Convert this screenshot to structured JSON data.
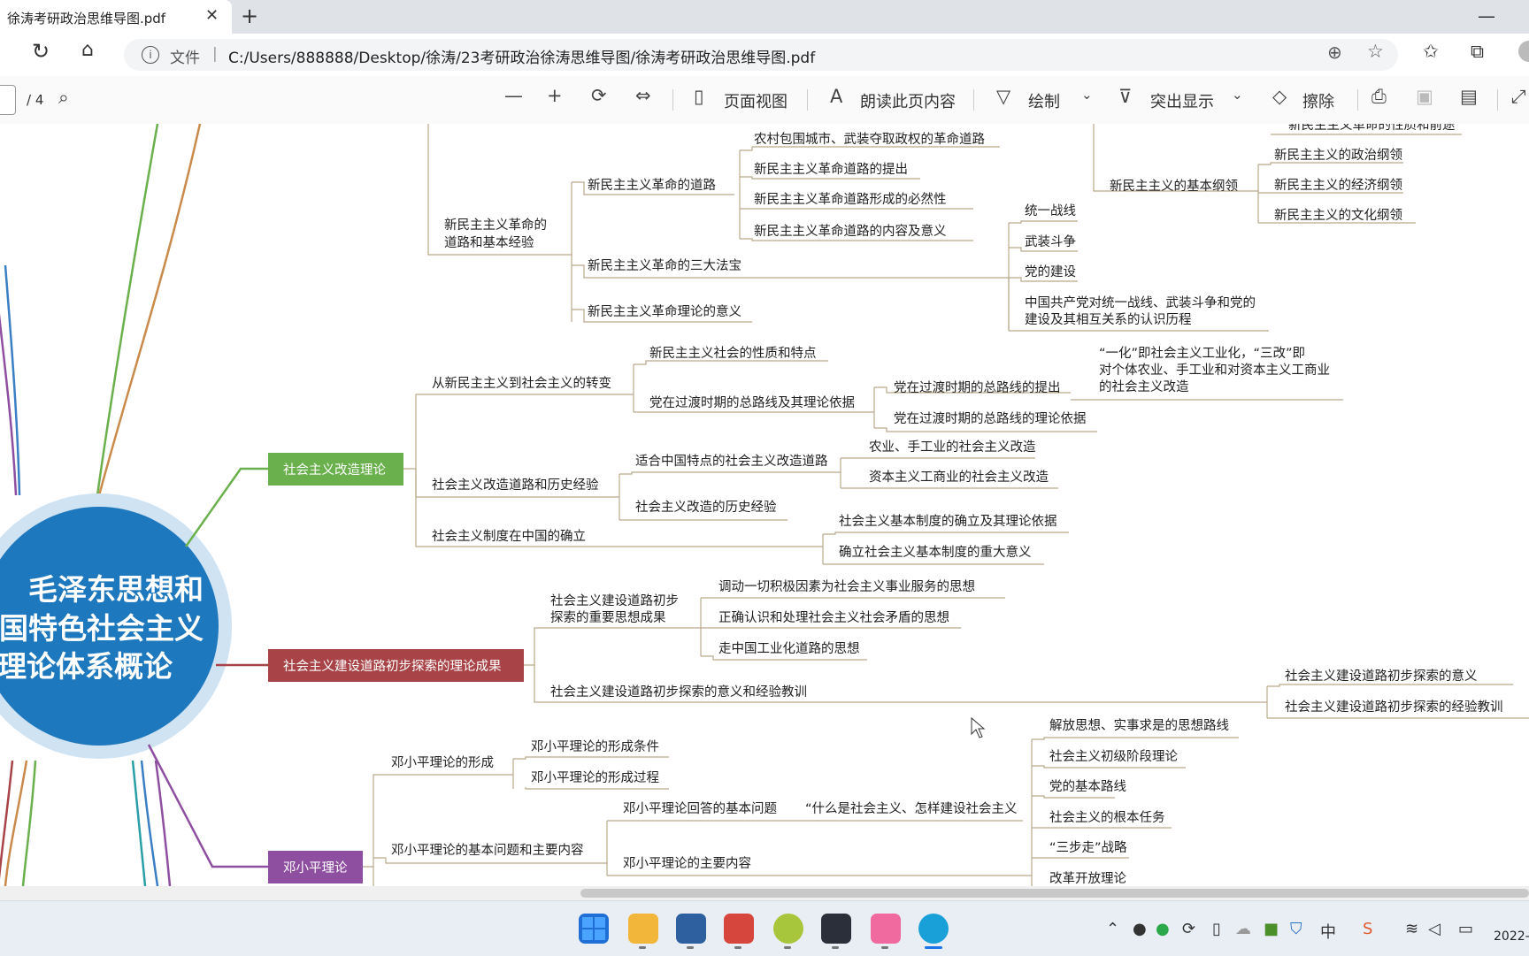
{
  "browser": {
    "tab_title": "徐涛考研政治思维导图.pdf",
    "address_label": "文件",
    "url": "C:/Users/888888/Desktop/徐涛/23考研政治徐涛思维导图/徐涛考研政治思维导图.pdf"
  },
  "pdf_toolbar": {
    "page_total": "/ 4",
    "page_view_label": "页面视图",
    "read_aloud_label": "朗读此页内容",
    "draw_label": "绘制",
    "highlight_label": "突出显示",
    "erase_label": "擦除"
  },
  "mindmap": {
    "center_lines": [
      "毛泽东思想和",
      "中国特色社会主义",
      "理论体系概论"
    ],
    "branches": {
      "socialist_transformation": "社会主义改造理论",
      "construction_exploration": "社会主义建设道路初步探索的理论成果",
      "deng_theory": "邓小平理论"
    },
    "colors": {
      "green": "#6ab04c",
      "red": "#a84448",
      "purple": "#8e4fa0",
      "center": "#1e78bd",
      "center_ring": "#cfe3f3",
      "line": "#b9a98a"
    },
    "top": {
      "road_basic_exp": [
        "新民主主义革命的",
        "道路和基本经验"
      ],
      "revolution_road": "新民主主义革命的道路",
      "road_items": [
        "农村包围城市、武装夺取政权的革命道路",
        "新民主主义革命道路的提出",
        "新民主主义革命道路形成的必然性",
        "新民主主义革命道路的内容及意义"
      ],
      "three_treasures": "新民主主义革命的三大法宝",
      "treasure_items": [
        "统一战线",
        "武装斗争",
        "党的建设"
      ],
      "treasure_history": [
        "中国共产党对统一战线、武装斗争和党的",
        "建设及其相互关系的认识历程"
      ],
      "theory_meaning": "新民主主义革命理论的意义",
      "cut_top_item": "新民主主义革命的性质和前途",
      "basic_program": "新民主主义的基本纲领",
      "program_items": [
        "新民主主义的政治纲领",
        "新民主主义的经济纲领",
        "新民主主义的文化纲领"
      ]
    },
    "transformation": {
      "transition": "从新民主主义到社会主义的转变",
      "society_nature": "新民主主义社会的性质和特点",
      "general_line": "党在过渡时期的总路线及其理论依据",
      "general_line_proposed": "党在过渡时期的总路线的提出",
      "general_line_basis": "党在过渡时期的总路线的理论依据",
      "yi_hua_san_gai": [
        "“一化”即社会主义工业化，“三改”即",
        "对个体农业、手工业和对资本主义工商业",
        "的社会主义改造"
      ],
      "road_and_exp": "社会主义改造道路和历史经验",
      "china_road": "适合中国特点的社会主义改造道路",
      "agri_handicraft": "农业、手工业的社会主义改造",
      "capitalist_commerce": "资本主义工商业的社会主义改造",
      "history_exp": "社会主义改造的历史经验",
      "system_established": "社会主义制度在中国的确立",
      "system_basis": "社会主义基本制度的确立及其理论依据",
      "system_meaning": "确立社会主义基本制度的重大意义"
    },
    "construction": {
      "important_results": [
        "社会主义建设道路初步",
        "探索的重要思想成果"
      ],
      "result_items": [
        "调动一切积极因素为社会主义事业服务的思想",
        "正确认识和处理社会主义社会矛盾的思想",
        "走中国工业化道路的思想"
      ],
      "meaning_lessons": "社会主义建设道路初步探索的意义和经验教训",
      "meaning": "社会主义建设道路初步探索的意义",
      "lessons": "社会主义建设道路初步探索的经验教训"
    },
    "deng": {
      "formation": "邓小平理论的形成",
      "conditions": "邓小平理论的形成条件",
      "process": "邓小平理论的形成过程",
      "basic_issues": "邓小平理论的基本问题和主要内容",
      "basic_question": "邓小平理论回答的基本问题",
      "what_is_socialism": "“什么是社会主义、怎样建设社会主义",
      "main_content": "邓小平理论的主要内容",
      "content_items": [
        "解放思想、实事求是的思想路线",
        "社会主义初级阶段理论",
        "党的基本路线",
        "社会主义的根本任务",
        "“三步走”战略",
        "改革开放理论"
      ]
    }
  },
  "taskbar": {
    "clock": "2022-"
  }
}
